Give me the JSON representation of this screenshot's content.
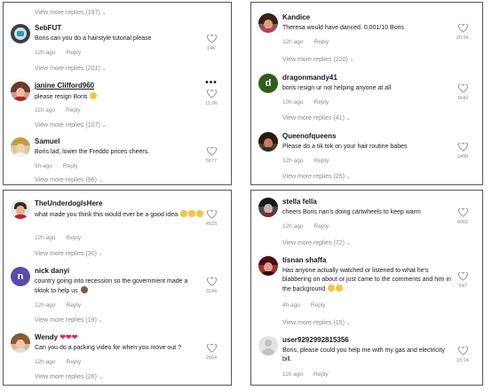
{
  "colors": {
    "text": "#161823",
    "muted": "#8a8b91",
    "border": "#555555"
  },
  "panels": [
    {
      "top_more": "View more replies (197)",
      "comments": [
        {
          "user": "SebFUT",
          "text": "Boris can you do a hairstyle tutorial please",
          "time": "12h ago",
          "reply": "Reply",
          "likes": "14K",
          "more": "View more replies (201)"
        },
        {
          "user": "janine Clifford960",
          "text": "please resign Boris",
          "time": "11h ago",
          "reply": "Reply",
          "likes": "11.2K",
          "more": "View more replies (107)",
          "options": "•••"
        },
        {
          "user": "Samuel",
          "text": "Boris lad, lower the Freddo prices cheers.",
          "time": "9h ago",
          "reply": "Reply",
          "likes": "5677",
          "more": "View more replies (96)"
        }
      ]
    },
    {
      "comments": [
        {
          "user": "Kandice",
          "text": "Theresa would have danced. 0.001/10 Boris",
          "time": "12h ago",
          "reply": "Reply",
          "likes": "20.5K",
          "more": "View more replies (220)"
        },
        {
          "user": "dragonmandy41",
          "avatar_letter": "d",
          "text": "boris resign ur not helping anyone at all",
          "time": "10h ago",
          "reply": "Reply",
          "likes": "1642",
          "more": "View more replies (41)"
        },
        {
          "user": "Queenofqueens",
          "text": "Please do a tik tok on your hair routine babes",
          "time": "12h ago",
          "reply": "Reply",
          "likes": "1499",
          "more": "View more replies (25)"
        }
      ]
    },
    {
      "comments": [
        {
          "user": "TheUnderdogIsHere",
          "text": "what made you think this would ever be a good idea",
          "time": "12h ago",
          "reply": "Reply",
          "likes": "4523",
          "more": "View more replies (30)"
        },
        {
          "user": "nick danyi",
          "avatar_letter": "n",
          "text": "country going into recession so the government made a tiktok to help us",
          "time": "12h ago",
          "reply": "Reply",
          "likes": "3144",
          "more": "View more replies (19)"
        },
        {
          "user": "Wendy",
          "text": "Can you do a packing video for when you move out ?",
          "time": "12h ago",
          "reply": "Reply",
          "likes": "2664",
          "more": "View more replies (26)"
        }
      ]
    },
    {
      "comments": [
        {
          "user": "stella fella",
          "text": "cheers Boris nan's doing cartwheels to keep warm",
          "time": "12h ago",
          "reply": "Reply",
          "likes": "6061",
          "more": "View more replies (72)"
        },
        {
          "user": "tisnan shaffa",
          "text": "Has anyone actually watched or listened to what he's blabbering on about or just came to the comments and him in the background",
          "time": "4h ago",
          "reply": "Reply",
          "likes": "547",
          "more": "View more replies (15)"
        },
        {
          "user": "user9292992815356",
          "text": "Boris, please could you help me with my gas and electricity bill.",
          "time": "11h ago",
          "reply": "Reply",
          "likes": "13.1K"
        }
      ]
    }
  ]
}
